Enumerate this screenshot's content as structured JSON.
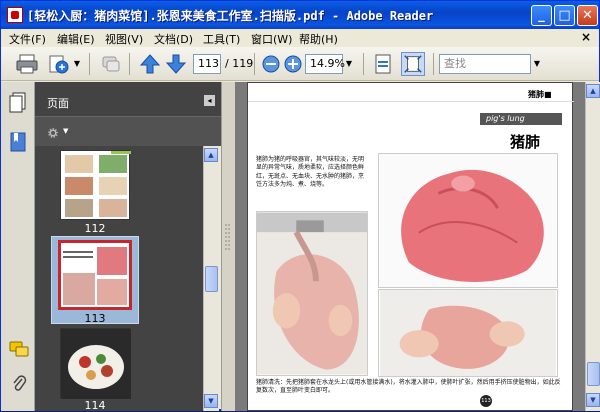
{
  "window": {
    "title": "[轻松入厨：猪肉菜馆].张恩来美食工作室.扫描版.pdf - Adobe Reader",
    "min": "_",
    "max": "□",
    "close": "✕"
  },
  "menu": [
    {
      "label": "文件(F)"
    },
    {
      "label": "编辑(E)"
    },
    {
      "label": "视图(V)"
    },
    {
      "label": "文档(D)"
    },
    {
      "label": "工具(T)"
    },
    {
      "label": "窗口(W)"
    },
    {
      "label": "帮助(H)"
    }
  ],
  "menu_close": "×",
  "toolbar": {
    "page_current": "113",
    "page_total": "/ 119",
    "zoom": "14.9%",
    "search_placeholder": "查找"
  },
  "pages_panel": {
    "title": "页面",
    "collapse": "◂",
    "thumbnails": [
      {
        "label": "112"
      },
      {
        "label": "113"
      },
      {
        "label": "114"
      }
    ]
  },
  "document": {
    "header": "猪肺■",
    "section_en": "pig's lung",
    "section_cn": "猪肺",
    "intro": "猪肺为猪的呼吸器官，其气味较淡，无明显的异常气味，质地柔软，应选择颜色鲜红，无斑点、无血块、无水肿的猪肺，烹饪方法多为炖、煮、烧等。",
    "bottom": "猪肺清洗：先把猪肺套在水龙头上(或用水管接满水)，将水灌入肺中，使肺叶扩张，然后用手挤压使脏物出，如此反复数次，直至肺叶变白即可。",
    "page_num": "113"
  },
  "colors": {
    "accent": "#0a5fe6",
    "thumb_selected_border": "#c8252c"
  }
}
